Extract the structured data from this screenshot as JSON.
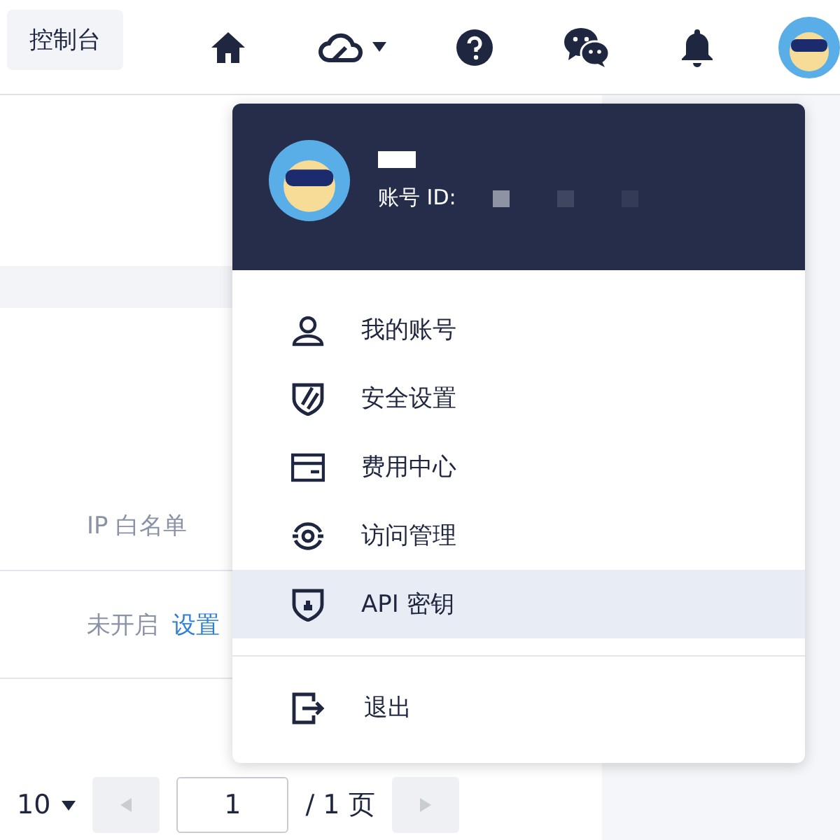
{
  "topbar": {
    "console_button": "控制台"
  },
  "page": {
    "field_label": "IP 白名单",
    "status": "未开启",
    "action_link": "设置",
    "pagination": {
      "page_size": "10",
      "page_input": "1",
      "page_total": "/ 1 页"
    }
  },
  "account_menu": {
    "id_label": "账号 ID:",
    "items": [
      {
        "kind": "user",
        "label": "我的账号",
        "selected": false
      },
      {
        "kind": "shield",
        "label": "安全设置",
        "selected": false
      },
      {
        "kind": "billing",
        "label": "费用中心",
        "selected": false
      },
      {
        "kind": "access",
        "label": "访问管理",
        "selected": false
      },
      {
        "kind": "key",
        "label": "API 密钥",
        "selected": true
      }
    ],
    "logout": "退出"
  }
}
